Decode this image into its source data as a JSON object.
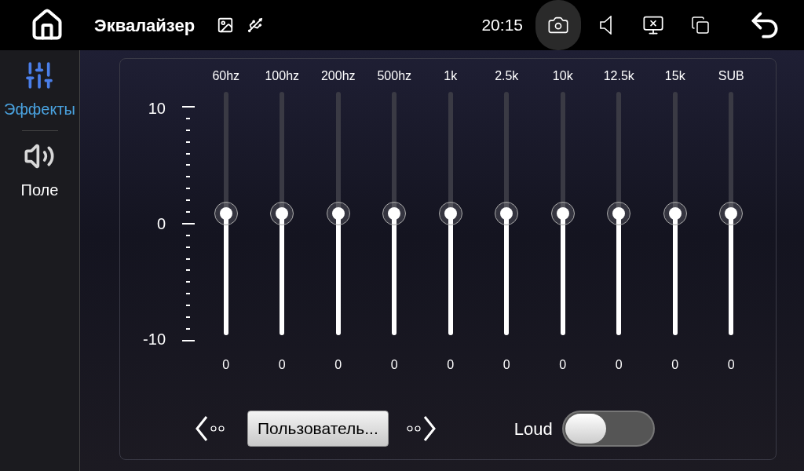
{
  "status_bar": {
    "title": "Эквалайзер",
    "time": "20:15"
  },
  "sidebar": {
    "items": [
      {
        "label": "Эффекты",
        "kind": "sliders",
        "selected": true
      },
      {
        "label": "Поле",
        "kind": "speaker",
        "selected": false
      }
    ]
  },
  "equalizer": {
    "scale": [
      "10",
      "0",
      "-10"
    ],
    "bands": [
      {
        "label": "60hz",
        "value": "0",
        "level": 0.5
      },
      {
        "label": "100hz",
        "value": "0",
        "level": 0.5
      },
      {
        "label": "200hz",
        "value": "0",
        "level": 0.5
      },
      {
        "label": "500hz",
        "value": "0",
        "level": 0.5
      },
      {
        "label": "1k",
        "value": "0",
        "level": 0.5
      },
      {
        "label": "2.5k",
        "value": "0",
        "level": 0.5
      },
      {
        "label": "10k",
        "value": "0",
        "level": 0.5
      },
      {
        "label": "12.5k",
        "value": "0",
        "level": 0.5
      },
      {
        "label": "15k",
        "value": "0",
        "level": 0.5
      },
      {
        "label": "SUB",
        "value": "0",
        "level": 0.5
      }
    ]
  },
  "preset": {
    "label": "Пользователь..."
  },
  "loud": {
    "label": "Loud",
    "on": false
  }
}
